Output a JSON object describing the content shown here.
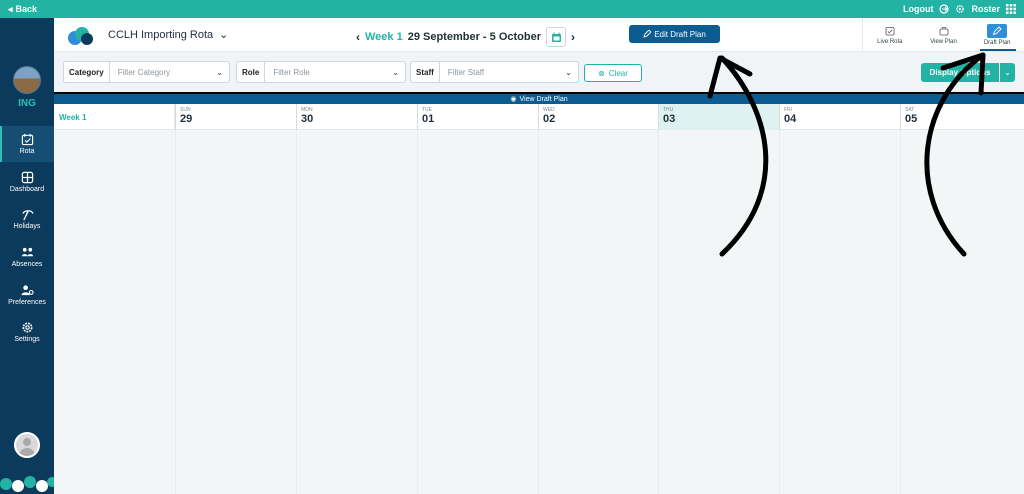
{
  "topbar": {
    "back_label": "Back",
    "logout_label": "Logout",
    "roster_label": "Roster"
  },
  "sidebar": {
    "org_name": "ING",
    "items": [
      {
        "label": "Rota",
        "icon": "calendar-icon",
        "active": true
      },
      {
        "label": "Dashboard",
        "icon": "dashboard-icon",
        "active": false
      },
      {
        "label": "Holidays",
        "icon": "holiday-icon",
        "active": false
      },
      {
        "label": "Absences",
        "icon": "absences-icon",
        "active": false
      },
      {
        "label": "Preferences",
        "icon": "preferences-icon",
        "active": false
      },
      {
        "label": "Settings",
        "icon": "gear-icon",
        "active": false
      }
    ]
  },
  "header": {
    "rota_name": "CCLH Importing Rota",
    "week_label": "Week 1",
    "date_range": "29 September - 5 October",
    "edit_button": "Edit Draft Plan",
    "view_tabs": [
      {
        "label": "Live Rota",
        "active": false
      },
      {
        "label": "View Plan",
        "active": false
      },
      {
        "label": "Draft Plan",
        "active": true
      }
    ]
  },
  "filters": {
    "category": {
      "label": "Category",
      "placeholder": "Filter Category"
    },
    "role": {
      "label": "Role",
      "placeholder": "Filter Role"
    },
    "staff": {
      "label": "Staff",
      "placeholder": "Filter Staff"
    },
    "clear_label": "Clear",
    "display_button": "Display Options"
  },
  "banner": {
    "label": "View Draft Plan"
  },
  "grid": {
    "week_label": "Week 1",
    "days": [
      {
        "name": "SUN",
        "date": "29",
        "today": false
      },
      {
        "name": "MON",
        "date": "30",
        "today": false
      },
      {
        "name": "TUE",
        "date": "01",
        "today": false
      },
      {
        "name": "WED",
        "date": "02",
        "today": false
      },
      {
        "name": "THU",
        "date": "03",
        "today": true
      },
      {
        "name": "FRI",
        "date": "04",
        "today": false
      },
      {
        "name": "SAT",
        "date": "05",
        "today": false
      }
    ]
  },
  "colors": {
    "teal": "#22b3a4",
    "navy": "#0c3a5c",
    "primary_blue": "#0c5c91"
  }
}
